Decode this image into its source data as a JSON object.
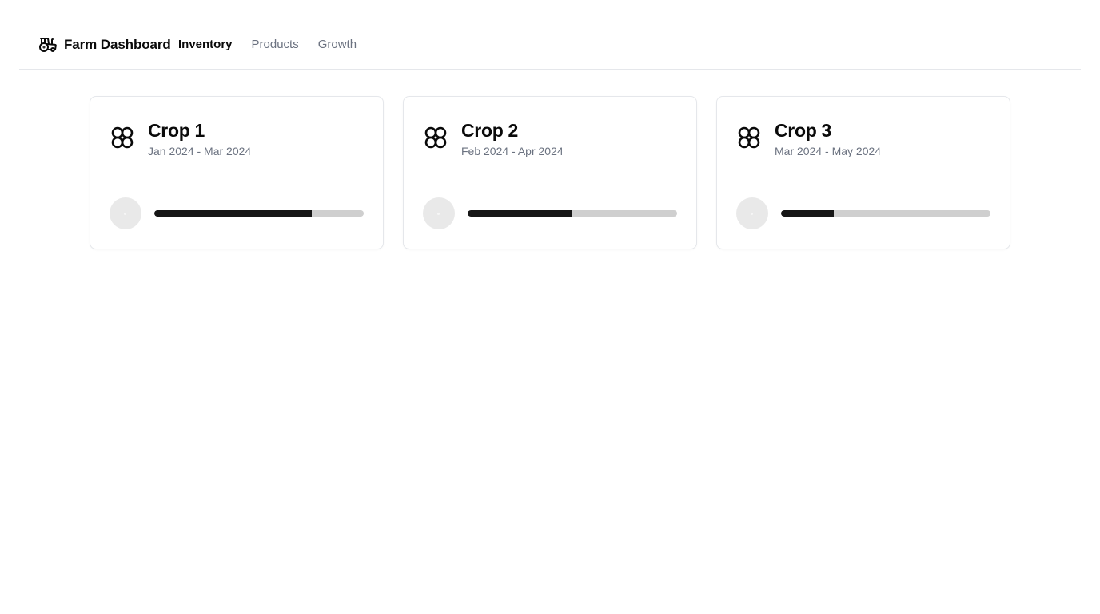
{
  "header": {
    "brand_name": "Farm Dashboard",
    "brand_icon": "tractor-icon",
    "nav": [
      {
        "label": "Inventory",
        "active": true
      },
      {
        "label": "Products",
        "active": false
      },
      {
        "label": "Growth",
        "active": false
      }
    ]
  },
  "crops": [
    {
      "title": "Crop 1",
      "dates": "Jan 2024 - Mar 2024",
      "icon": "flower-icon",
      "progress": 0.75
    },
    {
      "title": "Crop 2",
      "dates": "Feb 2024 - Apr 2024",
      "icon": "flower-icon",
      "progress": 0.5
    },
    {
      "title": "Crop 3",
      "dates": "Mar 2024 - May 2024",
      "icon": "flower-icon",
      "progress": 0.25
    }
  ],
  "colors": {
    "progress_fill": "#161616",
    "progress_track": "#cfcfcf",
    "muted_text": "#6b7280"
  }
}
